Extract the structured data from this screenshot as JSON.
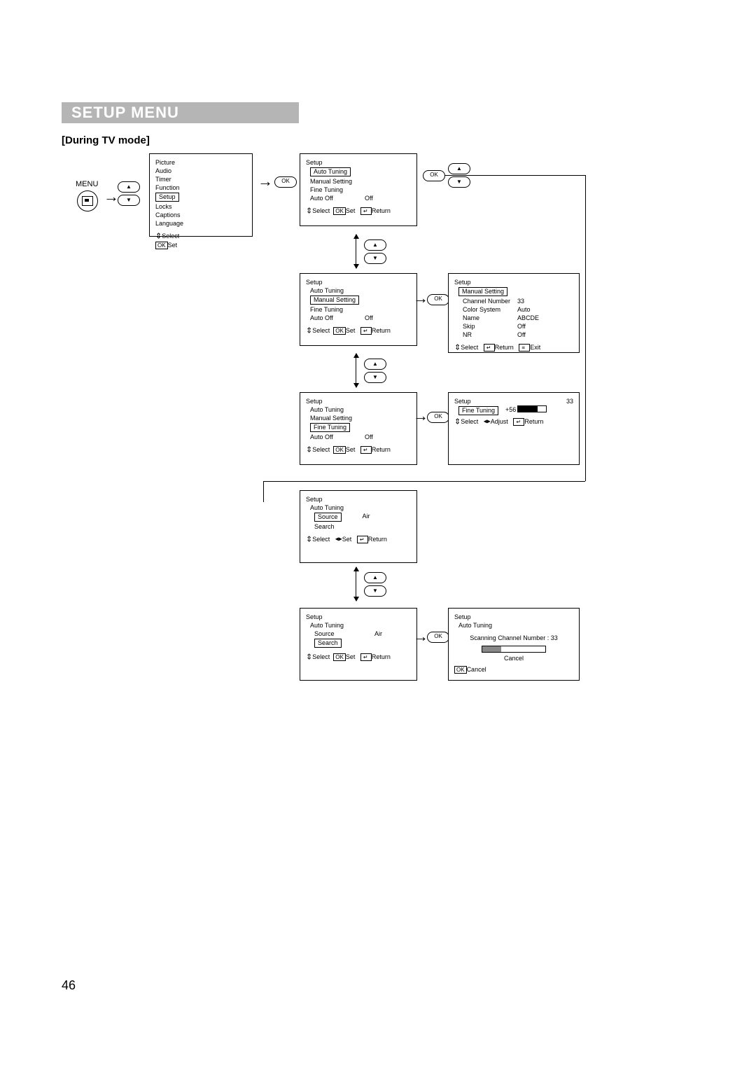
{
  "header": {
    "title": "SETUP MENU"
  },
  "subhead": "[During TV mode]",
  "page_number": "46",
  "menu_label": "MENU",
  "labels": {
    "ok": "OK",
    "select": "Select",
    "set": "Set",
    "return": "Return",
    "exit": "Exit",
    "adjust": "Adjust",
    "cancel": "Cancel"
  },
  "main_menu": {
    "items": [
      "Picture",
      "Audio",
      "Timer",
      "Function",
      "Setup",
      "Locks",
      "Captions",
      "Language"
    ],
    "selected_index": 4
  },
  "setup_autotuning": {
    "title": "Setup",
    "items": [
      {
        "label": "Auto Tuning",
        "value": ""
      },
      {
        "label": "Manual Setting",
        "value": ""
      },
      {
        "label": "Fine Tuning",
        "value": ""
      },
      {
        "label": "Auto Off",
        "value": "Off"
      }
    ],
    "selected_index": 0
  },
  "setup_manual": {
    "title": "Setup",
    "items": [
      {
        "label": "Auto Tuning",
        "value": ""
      },
      {
        "label": "Manual Setting",
        "value": ""
      },
      {
        "label": "Fine Tuning",
        "value": ""
      },
      {
        "label": "Auto Off",
        "value": "Off"
      }
    ],
    "selected_index": 1
  },
  "setup_fine": {
    "title": "Setup",
    "items": [
      {
        "label": "Auto Tuning",
        "value": ""
      },
      {
        "label": "Manual Setting",
        "value": ""
      },
      {
        "label": "Fine Tuning",
        "value": ""
      },
      {
        "label": "Auto Off",
        "value": "Off"
      }
    ],
    "selected_index": 2
  },
  "manual_setting_detail": {
    "title": "Setup",
    "header": "Manual Setting",
    "rows": [
      {
        "label": "Channel Number",
        "value": "33"
      },
      {
        "label": "Color System",
        "value": "Auto"
      },
      {
        "label": "Name",
        "value": "ABCDE"
      },
      {
        "label": "Skip",
        "value": "Off"
      },
      {
        "label": "NR",
        "value": "Off"
      }
    ]
  },
  "fine_tuning_detail": {
    "title": "Setup",
    "channel": "33",
    "header": "Fine Tuning",
    "value": "+56"
  },
  "auto_tuning_source": {
    "title": "Setup",
    "subtitle": "Auto Tuning",
    "rows": [
      {
        "label": "Source",
        "value": "Air"
      },
      {
        "label": "Search",
        "value": ""
      }
    ],
    "selected_index": 0
  },
  "auto_tuning_search": {
    "title": "Setup",
    "subtitle": "Auto Tuning",
    "rows": [
      {
        "label": "Source",
        "value": "Air"
      },
      {
        "label": "Search",
        "value": ""
      }
    ],
    "selected_index": 1
  },
  "scanning": {
    "title": "Setup",
    "subtitle": "Auto Tuning",
    "text": "Scanning Channel Number : 33",
    "cancel": "Cancel"
  }
}
